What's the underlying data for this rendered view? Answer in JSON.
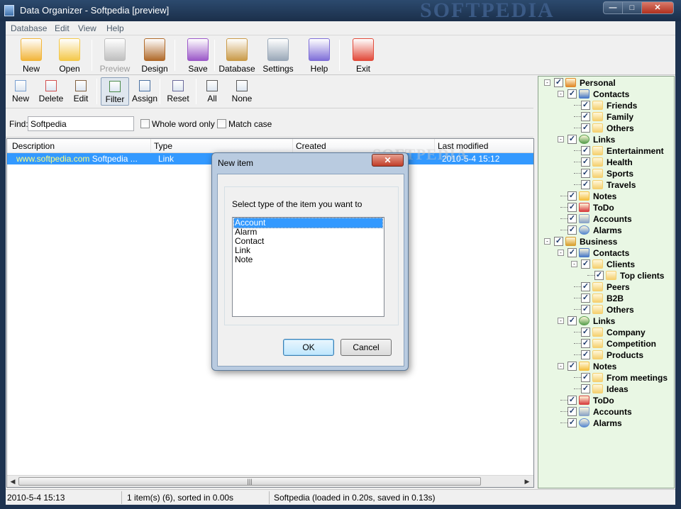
{
  "window": {
    "title": "Data Organizer - Softpedia [preview]",
    "watermark": "SOFTPEDIA",
    "min": "—",
    "max": "□",
    "close": "✕"
  },
  "menu": [
    "Database",
    "Edit",
    "View",
    "Help"
  ],
  "toolbar": [
    {
      "label": "New",
      "icon": "new-database-icon",
      "color": "#f2b53a"
    },
    {
      "label": "Open",
      "icon": "open-folder-icon",
      "color": "#f4c84a"
    },
    {
      "label": "Preview",
      "icon": "preview-icon",
      "color": "#bfbfbf",
      "disabled": true
    },
    {
      "label": "Design",
      "icon": "design-icon",
      "color": "#b06a2a"
    },
    {
      "label": "Save",
      "icon": "save-icon",
      "color": "#9b59c8"
    },
    {
      "label": "Database",
      "icon": "database-settings-icon",
      "color": "#c99a48"
    },
    {
      "label": "Settings",
      "icon": "settings-icon",
      "color": "#9aa8b8"
    },
    {
      "label": "Help",
      "icon": "help-icon",
      "color": "#7f6fd8"
    },
    {
      "label": "Exit",
      "icon": "exit-icon",
      "color": "#e24a3a"
    }
  ],
  "itemtoolbar": [
    {
      "label": "New",
      "icon": "new-item-icon"
    },
    {
      "label": "Delete",
      "icon": "delete-item-icon"
    },
    {
      "label": "Edit",
      "icon": "edit-item-icon"
    },
    {
      "label": "Filter",
      "icon": "filter-icon"
    },
    {
      "label": "Assign",
      "icon": "assign-icon"
    },
    {
      "label": "Reset",
      "icon": "reset-icon"
    },
    {
      "label": "All",
      "icon": "select-all-icon"
    },
    {
      "label": "None",
      "icon": "select-none-icon"
    }
  ],
  "find": {
    "label": "Find:",
    "value": "Softpedia",
    "whole_word": "Whole word only",
    "match_case": "Match case"
  },
  "list": {
    "columns": [
      "Description",
      "Type",
      "Created",
      "Last modified"
    ],
    "rows": [
      {
        "description": "www.softpedia.com Softpedia ...",
        "url_part": "www.softpedia.com",
        "desc_rest": "Softpedia ...",
        "type": "Link",
        "created": "",
        "modified": "2010-5-4 15:12"
      }
    ]
  },
  "status": {
    "datetime": "2010-5-4 15:13",
    "items": "1 item(s) (6), sorted in 0.00s",
    "db": "Softpedia (loaded in 0.20s, saved in 0.13s)"
  },
  "tree": [
    {
      "label": "Personal",
      "level": 0,
      "expander": "-",
      "icon": "person-icon",
      "color": "#e08a2a"
    },
    {
      "label": "Contacts",
      "level": 1,
      "expander": "-",
      "icon": "contacts-book-icon",
      "color": "#4a7ac8"
    },
    {
      "label": "Friends",
      "level": 2,
      "icon": "folder-icon",
      "color": "#f5d070"
    },
    {
      "label": "Family",
      "level": 2,
      "icon": "folder-icon",
      "color": "#f5d070"
    },
    {
      "label": "Others",
      "level": 2,
      "icon": "folder-icon",
      "color": "#f5d070"
    },
    {
      "label": "Links",
      "level": 1,
      "expander": "-",
      "icon": "globe-icon",
      "color": "#5aa050"
    },
    {
      "label": "Entertainment",
      "level": 2,
      "icon": "folder-icon",
      "color": "#f5d070"
    },
    {
      "label": "Health",
      "level": 2,
      "icon": "folder-icon",
      "color": "#f5d070"
    },
    {
      "label": "Sports",
      "level": 2,
      "icon": "folder-icon",
      "color": "#f5d070"
    },
    {
      "label": "Travels",
      "level": 2,
      "icon": "folder-icon",
      "color": "#f5d070"
    },
    {
      "label": "Notes",
      "level": 1,
      "icon": "notes-folder-icon",
      "color": "#f5c040"
    },
    {
      "label": "ToDo",
      "level": 1,
      "icon": "calendar-icon",
      "color": "#d84040"
    },
    {
      "label": "Accounts",
      "level": 1,
      "icon": "keyboard-icon",
      "color": "#8aa4c8"
    },
    {
      "label": "Alarms",
      "level": 1,
      "icon": "alarm-gear-icon",
      "color": "#5a8ad0"
    },
    {
      "label": "Business",
      "level": 0,
      "expander": "-",
      "icon": "business-icon",
      "color": "#d8a030"
    },
    {
      "label": "Contacts",
      "level": 1,
      "expander": "-",
      "icon": "contacts-book-icon",
      "color": "#4a7ac8"
    },
    {
      "label": "Clients",
      "level": 2,
      "expander": "-",
      "icon": "folder-icon",
      "color": "#f5d070"
    },
    {
      "label": "Top clients",
      "level": 3,
      "icon": "folder-icon",
      "color": "#f5d070"
    },
    {
      "label": "Peers",
      "level": 2,
      "icon": "folder-icon",
      "color": "#f5d070"
    },
    {
      "label": "B2B",
      "level": 2,
      "icon": "folder-icon",
      "color": "#f5d070"
    },
    {
      "label": "Others",
      "level": 2,
      "icon": "folder-icon",
      "color": "#f5d070"
    },
    {
      "label": "Links",
      "level": 1,
      "expander": "-",
      "icon": "globe-icon",
      "color": "#5aa050"
    },
    {
      "label": "Company",
      "level": 2,
      "icon": "folder-icon",
      "color": "#f5d070"
    },
    {
      "label": "Competition",
      "level": 2,
      "icon": "folder-icon",
      "color": "#f5d070"
    },
    {
      "label": "Products",
      "level": 2,
      "icon": "folder-icon",
      "color": "#f5d070"
    },
    {
      "label": "Notes",
      "level": 1,
      "expander": "-",
      "icon": "notes-folder-icon",
      "color": "#f5c040"
    },
    {
      "label": "From meetings",
      "level": 2,
      "icon": "folder-icon",
      "color": "#f5d070"
    },
    {
      "label": "Ideas",
      "level": 2,
      "icon": "folder-icon",
      "color": "#f5d070"
    },
    {
      "label": "ToDo",
      "level": 1,
      "icon": "calendar-icon",
      "color": "#d84040"
    },
    {
      "label": "Accounts",
      "level": 1,
      "icon": "keyboard-icon",
      "color": "#8aa4c8"
    },
    {
      "label": "Alarms",
      "level": 1,
      "icon": "alarm-gear-icon",
      "color": "#5a8ad0"
    }
  ],
  "dialog": {
    "title": "New item",
    "close": "✕",
    "prompt": "Select type of the item you want to",
    "options": [
      "Account",
      "Alarm",
      "Contact",
      "Link",
      "Note"
    ],
    "selected": "Account",
    "ok": "OK",
    "cancel": "Cancel"
  },
  "colors": {
    "selection": "#3399ff",
    "link_text": "#ffff80",
    "tree_bg": "#e9f7e4"
  }
}
